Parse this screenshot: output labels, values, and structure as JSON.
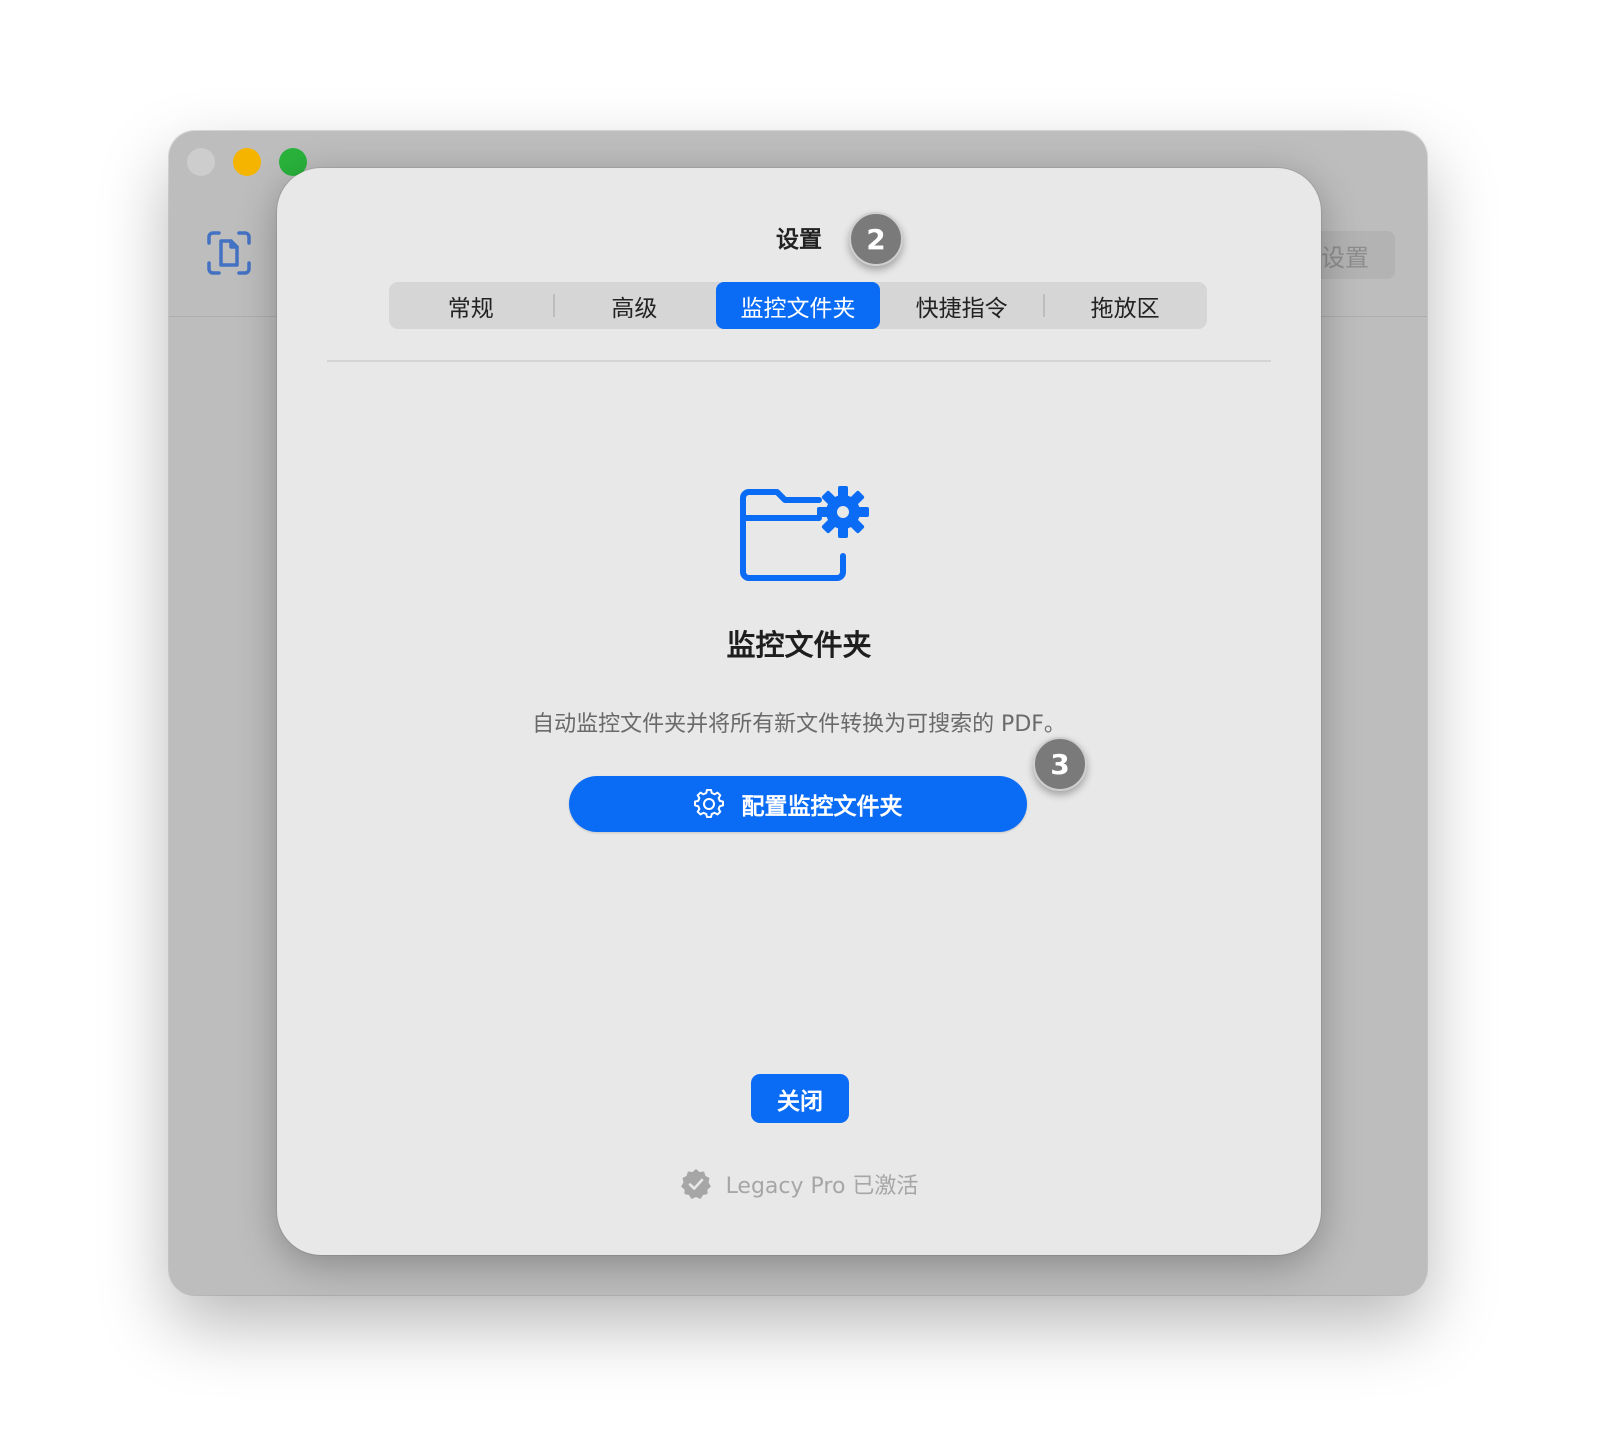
{
  "background_window": {
    "settings_button_label": "设置"
  },
  "sheet": {
    "title": "设置",
    "tabs": [
      "常规",
      "高级",
      "监控文件夹",
      "快捷指令",
      "拖放区"
    ],
    "active_tab": "监控文件夹",
    "heading": "监控文件夹",
    "description": "自动监控文件夹并将所有新文件转换为可搜索的 PDF。",
    "configure_button_label": "配置监控文件夹",
    "close_button_label": "关闭",
    "footer_status": "Legacy Pro 已激活"
  },
  "annotations": {
    "badge_title": "2",
    "badge_button": "3"
  },
  "colors": {
    "accent": "#0a6cf5",
    "traffic_close": "#cdcdcd",
    "traffic_minimize": "#f5b400",
    "traffic_maximize": "#29b33c",
    "badge": "#7a7a7a"
  },
  "icons": {
    "app": "document-scan-icon",
    "feature": "folder-gear-icon",
    "button": "gear-icon",
    "footer": "verified-seal-icon"
  }
}
